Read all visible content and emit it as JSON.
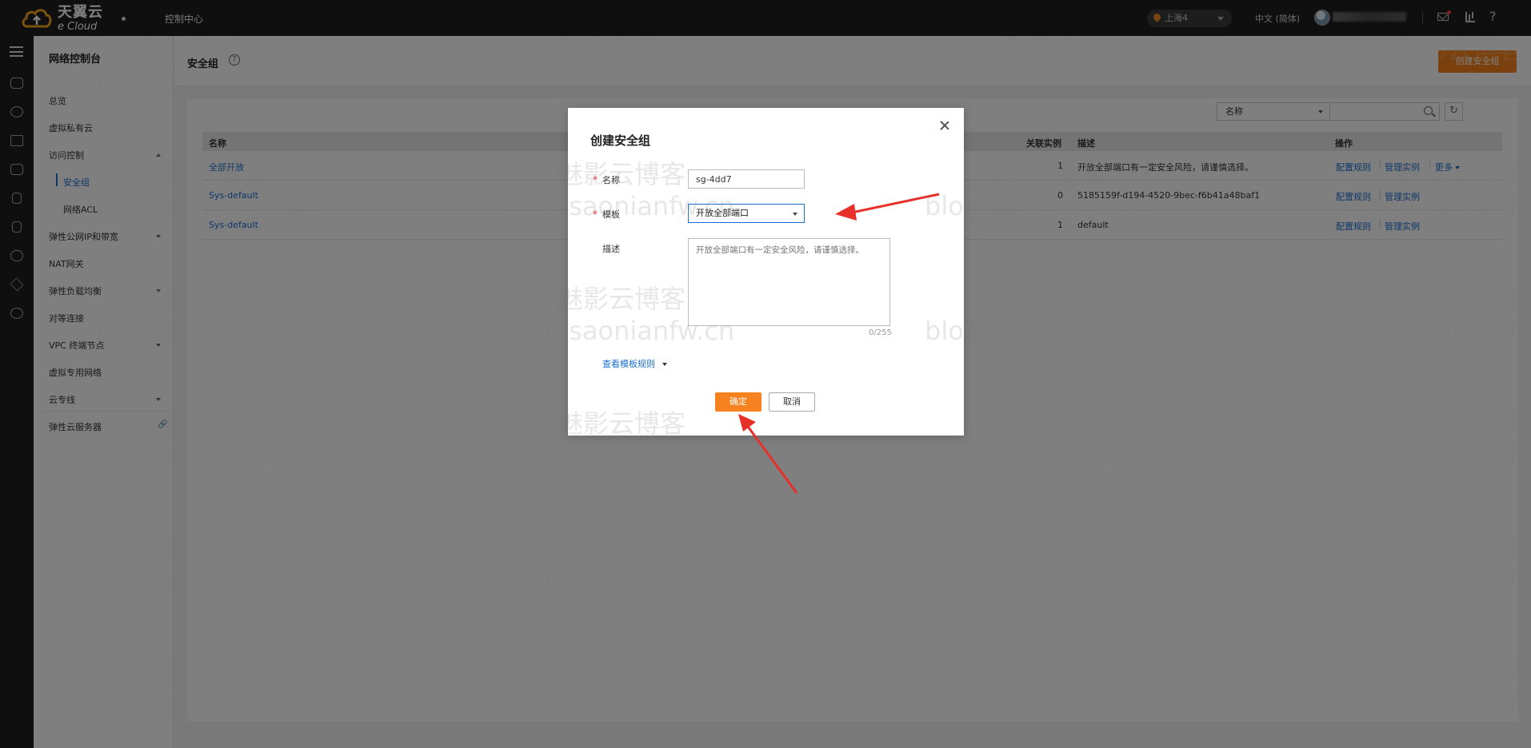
{
  "topbar": {
    "logo_cn": "天翼云",
    "logo_en": "e Cloud",
    "console": "控制中心",
    "region": "上海4",
    "language": "中文 (简体)"
  },
  "sidebar": {
    "title": "网络控制台",
    "items": {
      "overview": "总览",
      "vpc": "虚拟私有云",
      "access_control": "访问控制",
      "security_group": "安全组",
      "network_acl": "网络ACL",
      "eip_bandwidth": "弹性公网IP和带宽",
      "nat": "NAT网关",
      "elb": "弹性负载均衡",
      "peering": "对等连接",
      "vpc_endpoint": "VPC 终端节点",
      "vpn": "虚拟专用网络",
      "direct_connect": "云专线",
      "ecs": "弹性云服务器"
    }
  },
  "page": {
    "title": "安全组",
    "help_symbol": "?",
    "create_button": "创建安全组"
  },
  "filter": {
    "field": "名称",
    "refresh_symbol": "↻"
  },
  "table": {
    "headers": {
      "name": "名称",
      "related": "关联实例",
      "description": "描述",
      "actions": "操作"
    },
    "rows": [
      {
        "name": "全部开放",
        "related": "1",
        "description": "开放全部端口有一定安全风险，请谨慎选择。",
        "op1": "配置规则",
        "op2": "管理实例",
        "op3": "更多"
      },
      {
        "name": "Sys-default",
        "related": "0",
        "description": "5185159f-d194-4520-9bec-f6b41a48baf1",
        "op1": "配置规则",
        "op2": "管理实例"
      },
      {
        "name": "Sys-default",
        "related": "1",
        "description": "default",
        "op1": "配置规则",
        "op2": "管理实例"
      }
    ]
  },
  "modal": {
    "title": "创建安全组",
    "required_mark": "*",
    "name_label": "名称",
    "name_value": "sg-4dd7",
    "template_label": "模板",
    "template_value": "开放全部端口",
    "desc_label": "描述",
    "desc_placeholder": "开放全部端口有一定安全风险，请谨慎选择。",
    "counter": "0/255",
    "view_rules": "查看模板规则",
    "ok": "确定",
    "cancel": "取消"
  },
  "watermark": {
    "cn": "魅影云博客",
    "url": "blog.saonianfw.cn"
  },
  "colors": {
    "accent": "#f5821f",
    "link": "#1a6fd1",
    "annotation": "#e8302a"
  }
}
